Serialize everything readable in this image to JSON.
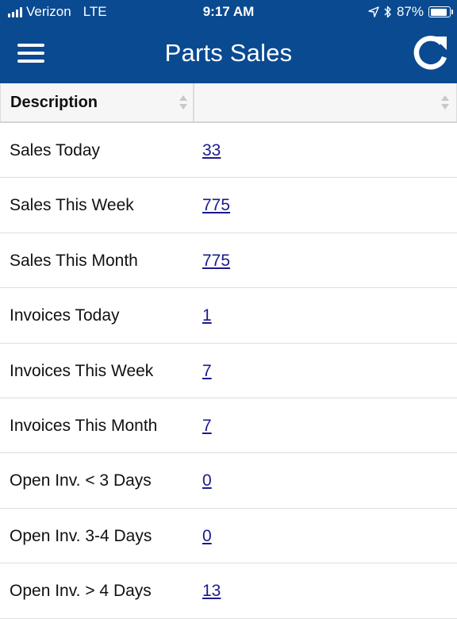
{
  "status_bar": {
    "carrier": "Verizon",
    "network": "LTE",
    "time": "9:17 AM",
    "battery_percent": "87%",
    "battery_level": 0.87,
    "icons": [
      "signal-bars-icon",
      "location-arrow-icon",
      "bluetooth-icon",
      "battery-icon"
    ]
  },
  "nav": {
    "title": "Parts Sales",
    "menu_icon": "hamburger-menu-icon",
    "refresh_icon": "refresh-icon"
  },
  "table": {
    "headers": [
      "Description",
      ""
    ],
    "rows": [
      {
        "description": "Sales Today",
        "value": "33"
      },
      {
        "description": "Sales This Week",
        "value": "775"
      },
      {
        "description": "Sales This Month",
        "value": "775"
      },
      {
        "description": "Invoices Today",
        "value": "1"
      },
      {
        "description": "Invoices This Week",
        "value": "7"
      },
      {
        "description": "Invoices This Month",
        "value": "7"
      },
      {
        "description": "Open Inv. < 3 Days",
        "value": "0"
      },
      {
        "description": "Open Inv. 3-4 Days",
        "value": "0"
      },
      {
        "description": "Open Inv. > 4 Days",
        "value": "13"
      }
    ]
  },
  "colors": {
    "header_blue": "#0a4a91",
    "link": "#1a1a8c",
    "table_header_bg": "#f6f6f6"
  }
}
